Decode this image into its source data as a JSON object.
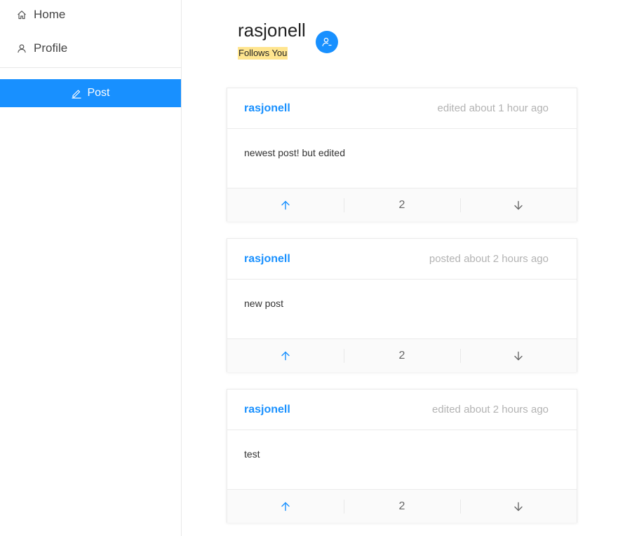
{
  "sidebar": {
    "items": [
      {
        "label": "Home",
        "icon": "home-icon"
      },
      {
        "label": "Profile",
        "icon": "user-icon"
      }
    ],
    "post_button_label": "Post",
    "post_icon": "edit-icon"
  },
  "profile": {
    "username": "rasjonell",
    "follows_badge": "Follows You",
    "follow_toggle_icon": "user-minus-icon"
  },
  "posts": [
    {
      "author": "rasjonell",
      "time": "edited about 1 hour ago",
      "content": "newest post! but edited",
      "votes": "2"
    },
    {
      "author": "rasjonell",
      "time": "posted about 2 hours ago",
      "content": "new post",
      "votes": "2"
    },
    {
      "author": "rasjonell",
      "time": "edited about 2 hours ago",
      "content": "test",
      "votes": "2"
    }
  ],
  "colors": {
    "accent": "#1890ff",
    "badge": "#ffe58f",
    "muted_text": "#b3b3b3"
  }
}
